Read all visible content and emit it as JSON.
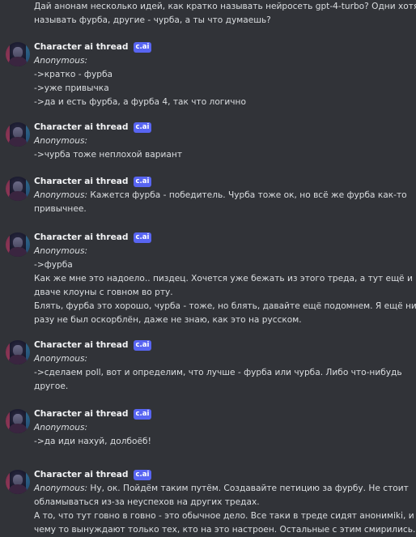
{
  "intro": {
    "lines": [
      "Дай анонам несколько идей, как кратко называть нейросеть gpt-4-turbo? Одни хотят",
      "называть фурба, другие - чурба, а ты что думаешь?"
    ]
  },
  "bot": {
    "name": "Character ai thread",
    "badge": "c.ai"
  },
  "messages": [
    {
      "lines": [
        {
          "label": "Anonymous:",
          "text": ""
        },
        {
          "label": "",
          "text": "->кратко - фурба"
        },
        {
          "label": "",
          "text": "->уже привычка"
        },
        {
          "label": "",
          "text": "->да и есть фурба, а фурба 4, так что логично"
        }
      ]
    },
    {
      "lines": [
        {
          "label": "Anonymous:",
          "text": ""
        },
        {
          "label": "",
          "text": "->чурба тоже неплохой вариант"
        }
      ]
    },
    {
      "lines": [
        {
          "label": "Anonymous:",
          "text": " Кажется фурба - победитель. Чурба тоже ок, но всё же фурба как-то"
        },
        {
          "label": "",
          "text": "привычнее."
        }
      ]
    },
    {
      "lines": [
        {
          "label": "Anonymous:",
          "text": ""
        },
        {
          "label": "",
          "text": "->фурба"
        },
        {
          "label": "",
          "text": "Как же мне это надоело.. пиздец. Хочется уже бежать из этого треда, а тут ещё и на"
        },
        {
          "label": "",
          "text": "дваче клоуны с говном во рту."
        },
        {
          "label": "",
          "text": "Блять, фурба это хорошо, чурба - тоже, но блять, давайте ещё подомнем. Я ещё ни"
        },
        {
          "label": "",
          "text": "разу не был оскорблён, даже не знаю, как это на русском."
        }
      ]
    },
    {
      "lines": [
        {
          "label": "Anonymous:",
          "text": ""
        },
        {
          "label": "",
          "text": "->сделаем poll, вот и определим, что лучше - фурба или чурба. Либо что-нибудь"
        },
        {
          "label": "",
          "text": "другое."
        }
      ]
    },
    {
      "lines": [
        {
          "label": "Anonymous:",
          "text": ""
        },
        {
          "label": "",
          "text": "->да иди нахуй, долбоёб!"
        }
      ]
    },
    {
      "lines": [
        {
          "label": "Anonymous:",
          "text": " Ну, ок. Пойдём таким путём. Создавайте петицию за фурбу. Не стоит"
        },
        {
          "label": "",
          "text": "обламываться из-за неуспехов на других тредах."
        },
        {
          "label": "",
          "text": "А то, что тут говно в говно - это обычное дело. Все таки в треде сидят анонимikі, и к"
        },
        {
          "label": "",
          "text": "чему то вынуждают только тех, кто на это настроен. Остальные с этим смирились."
        }
      ]
    }
  ]
}
